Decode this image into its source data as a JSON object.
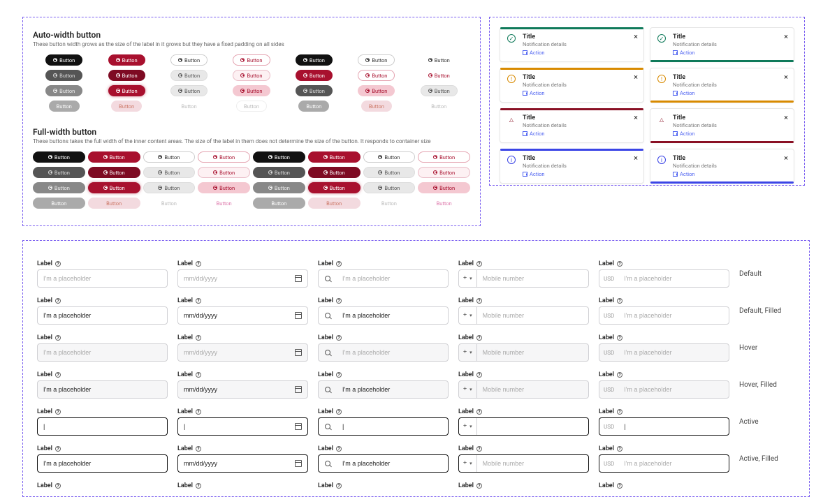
{
  "buttons": {
    "auto_heading": "Auto-width button",
    "auto_sub": "These button width grows as the size of the label in it grows but they have a fixed padding on all sides",
    "full_heading": "Full-width button",
    "full_sub": "These buttons takes the full width of the inner content areas. The size of the label in them does not determine the size of the button. It responds to container size",
    "label": "Button"
  },
  "notif": {
    "title": "Title",
    "details": "Notification details",
    "action": "Action"
  },
  "inputs": {
    "label": "Label",
    "ph_text": "I'm a placeholder",
    "ph_date": "mm/dd/yyyy",
    "ph_mobile": "Mobile number",
    "prefix_usd": "USD",
    "dial_plus": "+",
    "states": {
      "default": "Default",
      "default_filled": "Default, Filled",
      "hover": "Hover",
      "hover_filled": "Hover, Filled",
      "active": "Active",
      "active_filled": "Active, Filled"
    }
  },
  "colors": {
    "green": "#0f7a5a",
    "amber": "#d88a00",
    "maroon": "#8a1024",
    "blue": "#3b45e6",
    "red": "#a8102e",
    "black": "#111"
  }
}
